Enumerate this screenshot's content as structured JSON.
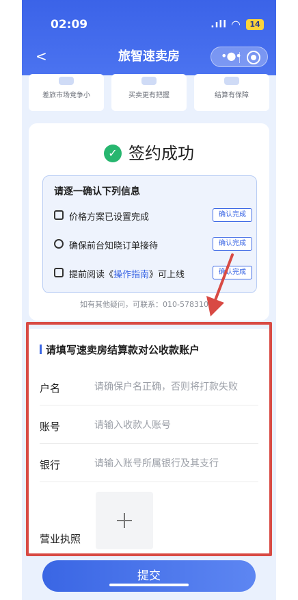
{
  "status_bar": {
    "time": "02:09",
    "signal": ".ıll",
    "wifi": "wifi",
    "battery": "14"
  },
  "nav": {
    "back": "<",
    "title": "旅智速卖房",
    "menu_icon": "more-dots-icon",
    "close_icon": "target-icon"
  },
  "features": [
    {
      "label": "差旅市场竞争小"
    },
    {
      "label": "买卖更有把握"
    },
    {
      "label": "结算有保障"
    }
  ],
  "success": {
    "title": "签约成功"
  },
  "confirm": {
    "heading": "请逐一确认下列信息",
    "items": [
      {
        "text": "价格方案已设置完成",
        "button": "确认完成"
      },
      {
        "text": "确保前台知晓订单接待",
        "button": "确认完成"
      },
      {
        "text_before": "提前阅读《",
        "link": "操作指南",
        "text_after": "》可上线",
        "button": "确认完成"
      }
    ],
    "contact": "如有其他疑问，可联系：010-57831036"
  },
  "account_form": {
    "title": "请填写速卖房结算款对公收款账户",
    "fields": [
      {
        "label": "户名",
        "placeholder": "请确保户名正确，否则将打款失败"
      },
      {
        "label": "账号",
        "placeholder": "请输入收款人账号"
      },
      {
        "label": "银行",
        "placeholder": "请输入账号所属银行及其支行"
      }
    ],
    "license_label": "营业执照"
  },
  "submit": {
    "label": "提交"
  },
  "colors": {
    "primary": "#3a66e4",
    "success": "#27b66f",
    "highlight": "#d84a44"
  }
}
